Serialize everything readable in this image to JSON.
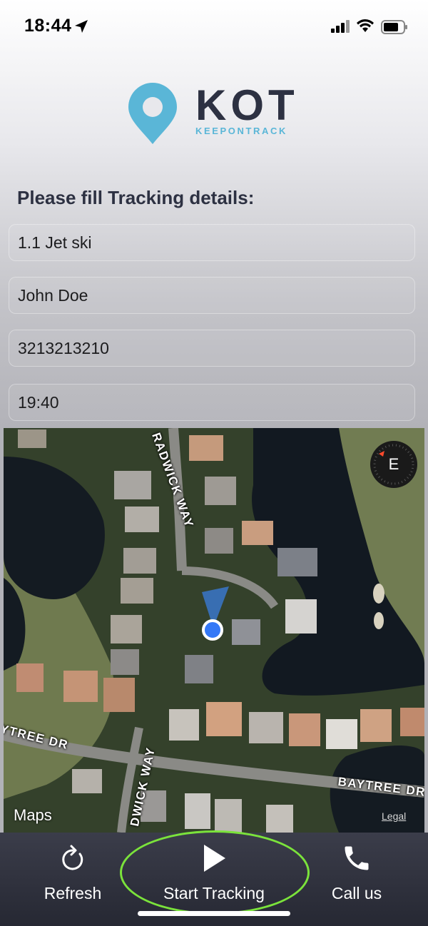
{
  "status": {
    "time": "18:44"
  },
  "logo": {
    "name": "KOT",
    "tagline": "KEEPONTRACK"
  },
  "form": {
    "heading": "Please fill Tracking details:",
    "fields": [
      "1.1 Jet ski",
      "John Doe",
      "3213213210",
      "19:40"
    ]
  },
  "map": {
    "streets": [
      "RADWICK WAY",
      "YTREE DR",
      "DWICK WAY",
      "BAYTREE DR"
    ],
    "compass_heading": "E",
    "attribution": "Maps",
    "legal": "Legal"
  },
  "nav": {
    "refresh": "Refresh",
    "start": "Start Tracking",
    "call": "Call us"
  },
  "colors": {
    "accent": "#5ab6d7",
    "highlight": "#7be33b",
    "user_location": "#3478f6"
  }
}
